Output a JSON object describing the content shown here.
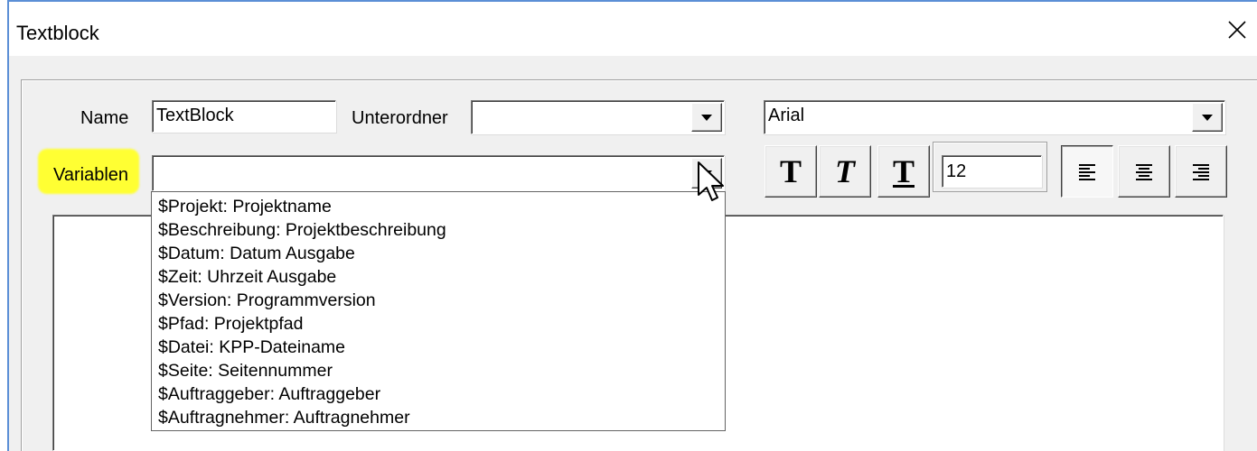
{
  "window": {
    "title": "Textblock"
  },
  "form": {
    "name_label": "Name",
    "name_value": "TextBlock",
    "subfolder_label": "Unterordner",
    "subfolder_value": "",
    "font_value": "Arial",
    "variables_label": "Variablen",
    "variables_value": ""
  },
  "toolbar": {
    "bold_glyph": "T",
    "italic_glyph": "T",
    "underline_glyph": "T",
    "font_size": "12",
    "align_left_pressed": true
  },
  "variables_options": [
    "$Projekt: Projektname",
    "$Beschreibung: Projektbeschreibung",
    "$Datum: Datum Ausgabe",
    "$Zeit: Uhrzeit Ausgabe",
    "$Version: Programmversion",
    "$Pfad: Projektpfad",
    "$Datei: KPP-Dateiname",
    "$Seite: Seitennummer",
    "$Auftraggeber: Auftraggeber",
    "$Auftragnehmer: Auftragnehmer"
  ],
  "icons": {
    "close": "close-icon",
    "dropdown": "chevron-down-icon",
    "align_left": "align-left-icon",
    "align_center": "align-center-icon",
    "align_right": "align-right-icon",
    "cursor": "mouse-pointer-icon"
  },
  "colors": {
    "highlight": "#ffff33",
    "window_border": "#5b8fd6",
    "dialog_bg": "#f0f0f0"
  }
}
